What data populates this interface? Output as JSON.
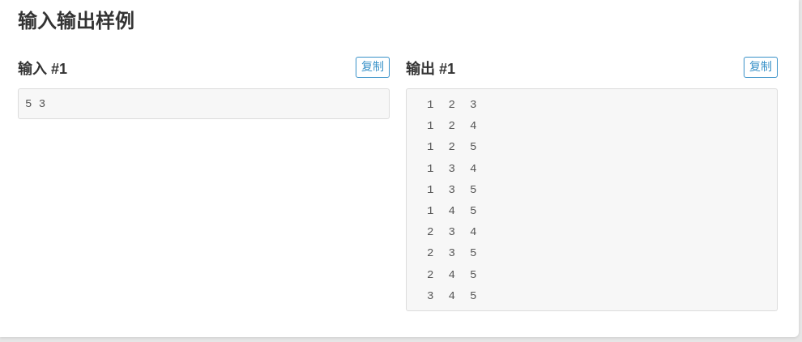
{
  "section": {
    "title": "输入输出样例"
  },
  "input": {
    "title": "输入 #1",
    "copy_label": "复制",
    "content": "5 3"
  },
  "output": {
    "title": "输出 #1",
    "copy_label": "复制",
    "rows": [
      [
        "1",
        "2",
        "3"
      ],
      [
        "1",
        "2",
        "4"
      ],
      [
        "1",
        "2",
        "5"
      ],
      [
        "1",
        "3",
        "4"
      ],
      [
        "1",
        "3",
        "5"
      ],
      [
        "1",
        "4",
        "5"
      ],
      [
        "2",
        "3",
        "4"
      ],
      [
        "2",
        "3",
        "5"
      ],
      [
        "2",
        "4",
        "5"
      ],
      [
        "3",
        "4",
        "5"
      ]
    ]
  },
  "colors": {
    "accent": "#3891c8",
    "code_background": "#f7f7f7",
    "code_border": "#dcdcdc",
    "heading": "#333333"
  }
}
